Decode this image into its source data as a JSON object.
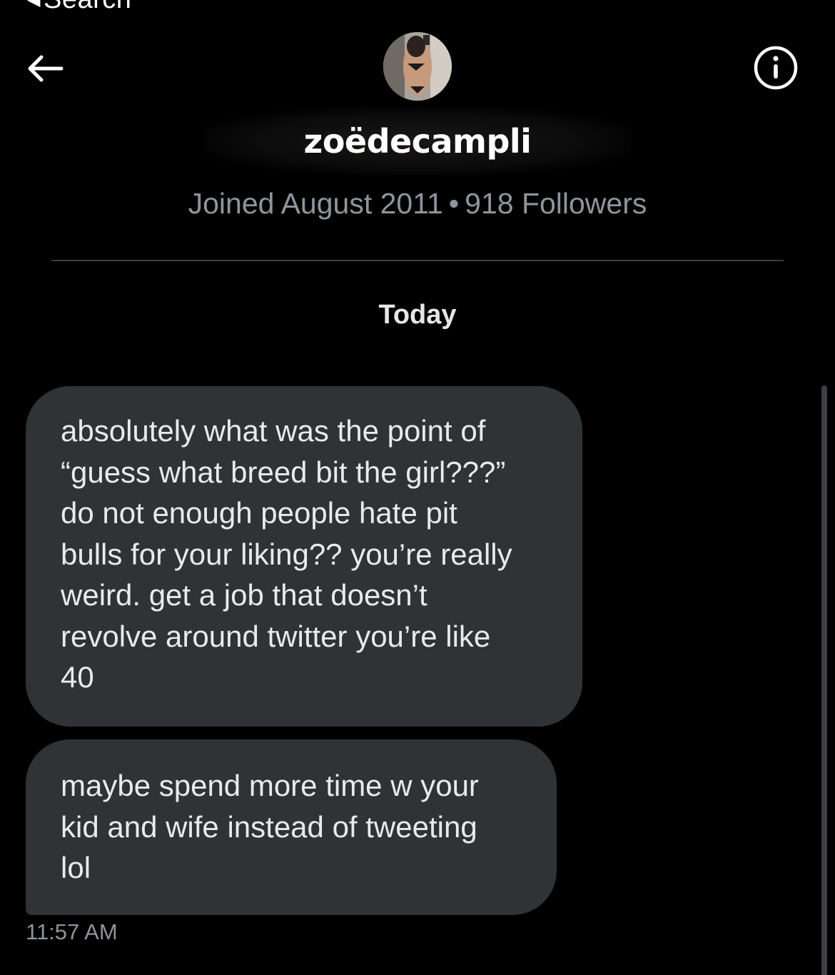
{
  "status_bar": {
    "back_to_app_label": "Search"
  },
  "header": {
    "username": "zoëdecampli",
    "joined_text": "Joined August 2011",
    "separator": "•",
    "followers_text": "918 Followers"
  },
  "conversation": {
    "day_label": "Today",
    "messages": [
      {
        "lines": [
          "absolutely what was the point of",
          "“guess what breed bit the girl???”",
          "do not enough people hate pit",
          "bulls for your liking?? you’re really",
          "weird. get a job that doesn’t",
          "revolve around twitter you’re like",
          "40"
        ]
      },
      {
        "lines": [
          "maybe spend more time w your",
          "kid and wife instead of tweeting",
          "lol"
        ]
      }
    ],
    "last_timestamp": "11:57 AM"
  },
  "colors": {
    "background": "#000000",
    "bubble": "#2f3336",
    "secondary_text": "#8e959c",
    "divider": "#3a3d42"
  },
  "icons": {
    "back": "arrow-left-icon",
    "info": "info-icon"
  }
}
